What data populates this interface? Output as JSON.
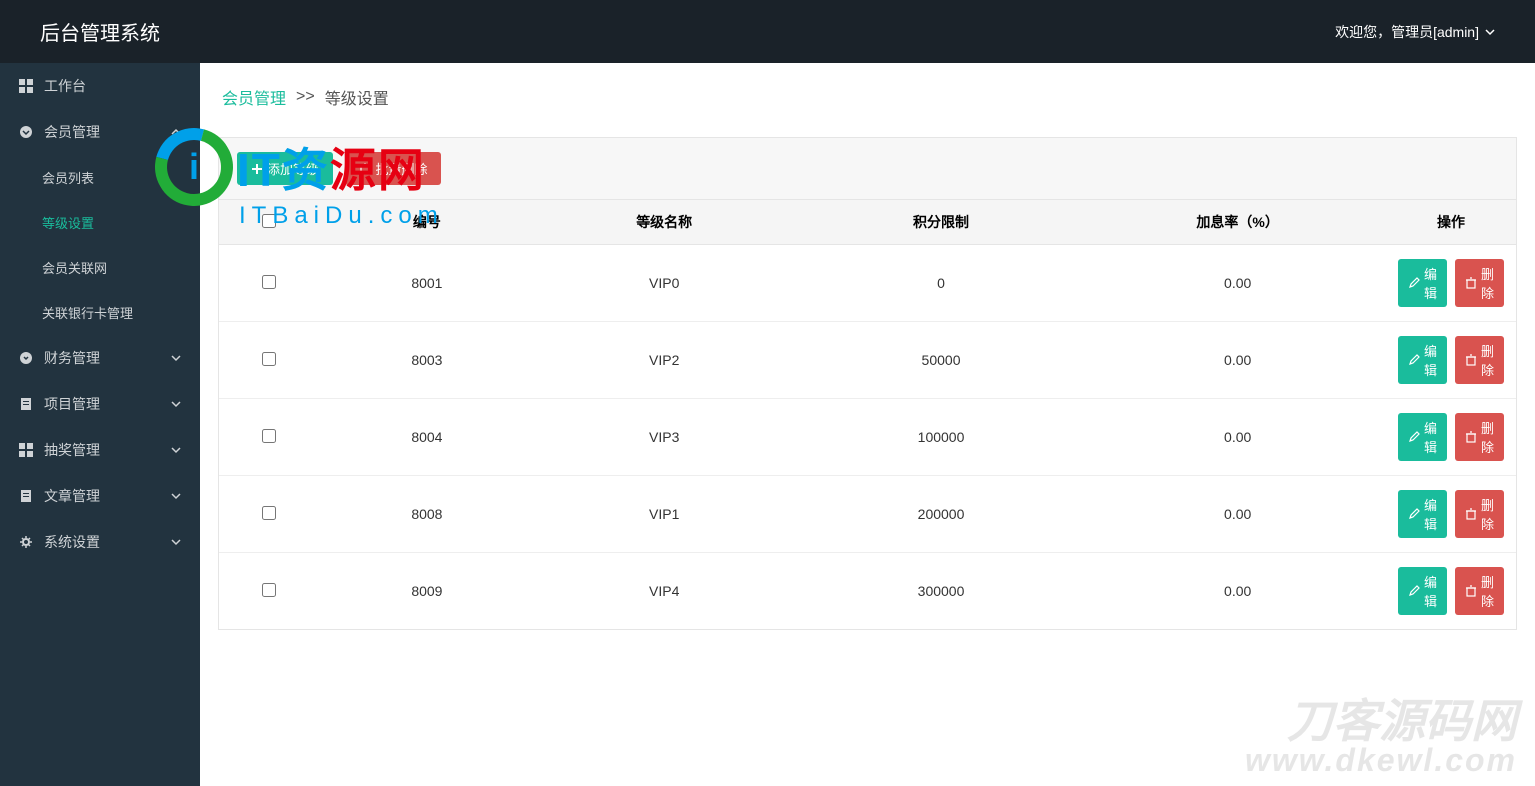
{
  "header": {
    "title": "后台管理系统",
    "welcome": "欢迎您，管理员[admin]"
  },
  "sidebar": {
    "items": [
      {
        "icon": "dashboard",
        "label": "工作台",
        "expandable": false
      },
      {
        "icon": "circle",
        "label": "会员管理",
        "expandable": true,
        "expanded": true,
        "children": [
          {
            "label": "会员列表",
            "active": false
          },
          {
            "label": "等级设置",
            "active": true
          },
          {
            "label": "会员关联网",
            "active": false
          },
          {
            "label": "关联银行卡管理",
            "active": false
          }
        ]
      },
      {
        "icon": "circle",
        "label": "财务管理",
        "expandable": true,
        "expanded": false
      },
      {
        "icon": "doc",
        "label": "项目管理",
        "expandable": true,
        "expanded": false
      },
      {
        "icon": "grid",
        "label": "抽奖管理",
        "expandable": true,
        "expanded": false
      },
      {
        "icon": "doc",
        "label": "文章管理",
        "expandable": true,
        "expanded": false
      },
      {
        "icon": "gear",
        "label": "系统设置",
        "expandable": true,
        "expanded": false
      }
    ]
  },
  "breadcrumb": {
    "parent": "会员管理",
    "separator": ">>",
    "current": "等级设置"
  },
  "toolbar": {
    "add_label": "添加等级",
    "batch_delete_label": "批量删除"
  },
  "table": {
    "headers": {
      "id": "编号",
      "name": "等级名称",
      "limit": "积分限制",
      "rate": "加息率（%）",
      "ops": "操作"
    },
    "edit_label": "编辑",
    "delete_label": "删除",
    "rows": [
      {
        "id": "8001",
        "name": "VIP0",
        "limit": "0",
        "rate": "0.00"
      },
      {
        "id": "8003",
        "name": "VIP2",
        "limit": "50000",
        "rate": "0.00"
      },
      {
        "id": "8004",
        "name": "VIP3",
        "limit": "100000",
        "rate": "0.00"
      },
      {
        "id": "8008",
        "name": "VIP1",
        "limit": "200000",
        "rate": "0.00"
      },
      {
        "id": "8009",
        "name": "VIP4",
        "limit": "300000",
        "rate": "0.00"
      }
    ]
  },
  "overlay": {
    "logo_letter": "i",
    "logo_text_1": "IT资",
    "logo_text_2": "源网",
    "logo_sub": "ITBaiDu.com"
  },
  "watermark": {
    "line1": "刀客源码网",
    "line2": "www.dkewl.com"
  }
}
